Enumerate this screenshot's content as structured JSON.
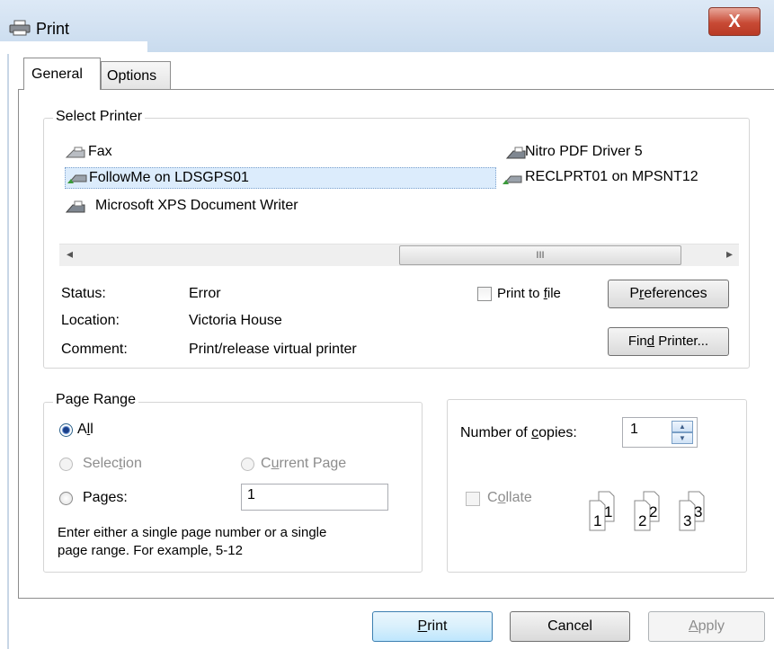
{
  "window": {
    "title": "Print",
    "close_glyph": "X"
  },
  "tabs": [
    {
      "label": "General"
    },
    {
      "label": "Options"
    }
  ],
  "select_printer": {
    "legend": "Select Printer",
    "printers": [
      {
        "name": "Fax",
        "icon": "fax-icon"
      },
      {
        "name": "FollowMe on LDSGPS01",
        "icon": "network-printer-icon",
        "selected": true
      },
      {
        "name": "Microsoft XPS Document Writer",
        "icon": "printer-icon"
      },
      {
        "name": "Nitro PDF Driver 5",
        "icon": "printer-icon"
      },
      {
        "name": "RECLPRT01 on MPSNT12",
        "icon": "network-printer-icon"
      }
    ],
    "scroll_left": "◂",
    "scroll_right": "▸",
    "scroll_grip": "III",
    "status_label": "Status:",
    "status_value": "Error",
    "location_label": "Location:",
    "location_value": "Victoria House",
    "comment_label": "Comment:",
    "comment_value": "Print/release virtual printer",
    "print_to_file": {
      "prefix": "Print to ",
      "key": "f",
      "suffix": "ile",
      "checked": false
    },
    "preferences_btn": {
      "prefix": "P",
      "key": "r",
      "suffix": "eferences"
    },
    "find_printer_btn": {
      "prefix": "Fin",
      "key": "d",
      "suffix": " Printer..."
    }
  },
  "page_range": {
    "legend": "Page Range",
    "all": {
      "prefix": "A",
      "key": "l",
      "suffix": "l",
      "selected": true
    },
    "selection": {
      "prefix": "Selec",
      "key": "t",
      "suffix": "ion"
    },
    "current_page": {
      "prefix": "C",
      "key": "u",
      "suffix": "rrent Page"
    },
    "pages": {
      "prefix": "Pa",
      "key": "g",
      "suffix": "es:",
      "value": "1"
    },
    "hint_line1": "Enter either a single page number or a single",
    "hint_line2": "page range.  For example, 5-12"
  },
  "copies": {
    "label_prefix": "Number of ",
    "label_key": "c",
    "label_suffix": "opies:",
    "value": "1",
    "collate": {
      "prefix": "C",
      "key": "o",
      "suffix": "llate",
      "checked": false
    },
    "collate_pages": [
      "1",
      "1",
      "2",
      "2",
      "3",
      "3"
    ]
  },
  "footer": {
    "print": {
      "key": "P",
      "suffix": "rint"
    },
    "cancel": "Cancel",
    "apply": {
      "key": "A",
      "suffix": "pply"
    }
  },
  "colors": {
    "selection_highlight": "#dcecfc",
    "selection_border": "#7da2ce",
    "close_red": "#c84a35"
  }
}
